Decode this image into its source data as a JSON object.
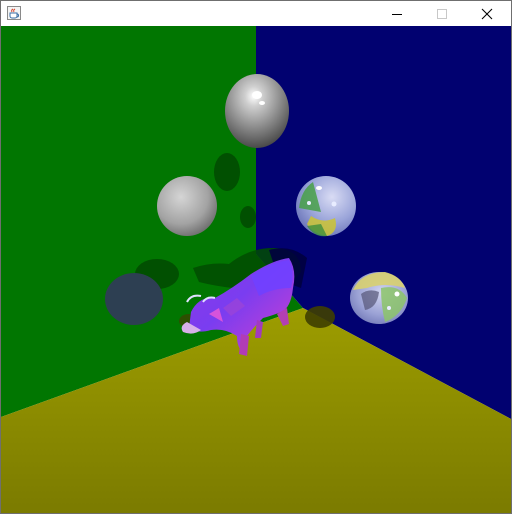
{
  "window": {
    "title": "",
    "controls": [
      "minimize",
      "maximize",
      "close"
    ],
    "icon": "java-cup-icon"
  },
  "scene": {
    "description_colors": {
      "left_wall": "#007400",
      "right_wall": "#00006e",
      "floor": "#878700",
      "sphere_gray": "#a7a7a7",
      "sphere_transparent": "#8ea8d8",
      "cow": "#cc33cc"
    }
  }
}
